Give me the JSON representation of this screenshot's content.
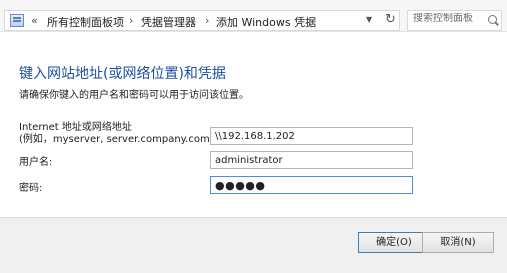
{
  "address_bar": {
    "overflow": "«",
    "crumbs": [
      "所有控制面板项",
      "凭据管理器",
      "添加 Windows 凭据"
    ],
    "separator": "›",
    "dropdown_glyph": "▼",
    "refresh_glyph": "↻",
    "search_placeholder": "搜索控制面板"
  },
  "main": {
    "title": "键入网站地址(或网络位置)和凭据",
    "subtitle": "请确保你键入的用户名和密码可以用于访问该位置。",
    "address_label_line1": "Internet 地址或网络地址",
    "address_label_line2": "(例如，myserver, server.company.com):",
    "address_value": "\\\\192.168.1.202",
    "username_label": "用户名:",
    "username_value": "administrator",
    "password_label": "密码:",
    "password_value": "●●●●●"
  },
  "buttons": {
    "ok_label": "确定(O)",
    "cancel_label": "取消(N)"
  }
}
